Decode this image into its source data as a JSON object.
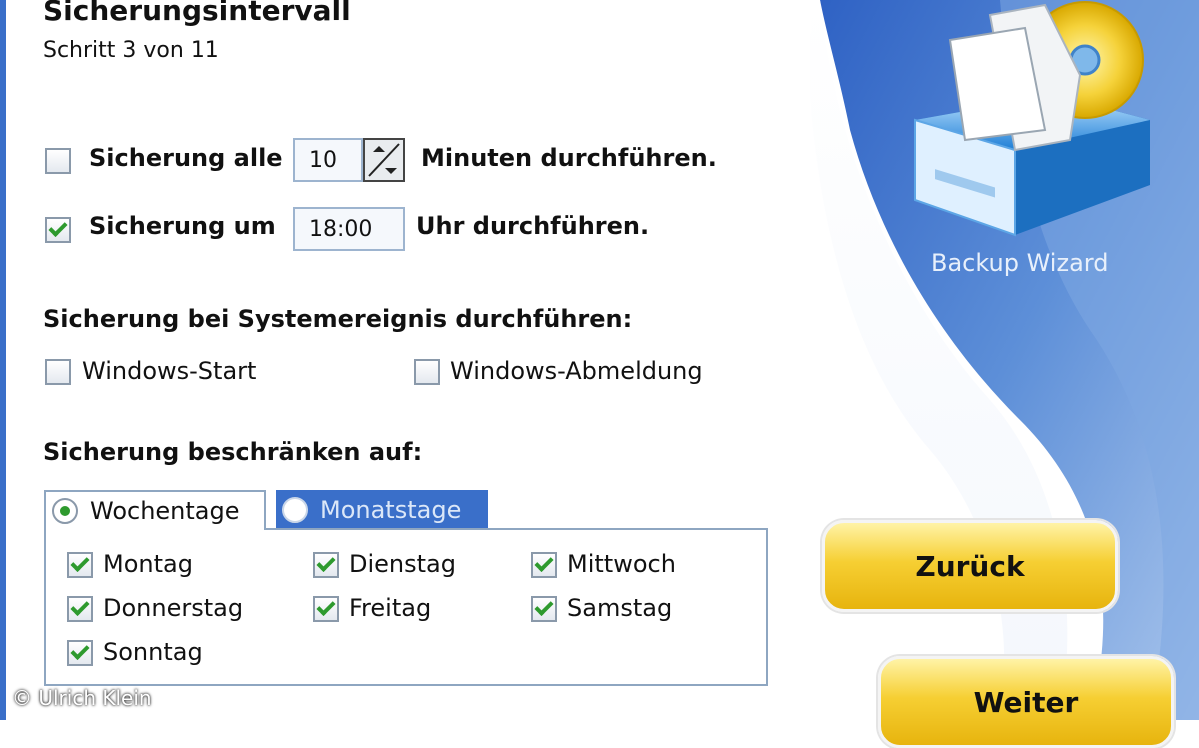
{
  "header": {
    "title": "Sicherungsintervall",
    "step": "Schritt 3 von 11"
  },
  "interval": {
    "every": {
      "checked": false,
      "label": "Sicherung alle",
      "value": "10",
      "suffix": "Minuten durchführen."
    },
    "at": {
      "checked": true,
      "label": "Sicherung um",
      "value": "18:00",
      "suffix": "Uhr durchführen."
    }
  },
  "events": {
    "heading": "Sicherung bei Systemereignis durchführen:",
    "windows_start": {
      "checked": false,
      "label": "Windows-Start"
    },
    "windows_logoff": {
      "checked": false,
      "label": "Windows-Abmeldung"
    }
  },
  "restrict": {
    "heading": "Sicherung beschränken auf:",
    "tabs": [
      {
        "label": "Wochentage",
        "selected": true
      },
      {
        "label": "Monatstage",
        "selected": false
      }
    ],
    "days": [
      {
        "label": "Montag",
        "checked": true
      },
      {
        "label": "Dienstag",
        "checked": true
      },
      {
        "label": "Mittwoch",
        "checked": true
      },
      {
        "label": "Donnerstag",
        "checked": true
      },
      {
        "label": "Freitag",
        "checked": true
      },
      {
        "label": "Samstag",
        "checked": true
      },
      {
        "label": "Sonntag",
        "checked": true
      }
    ]
  },
  "sidebar": {
    "wizard_label": "Backup Wizard",
    "icon": "backup-drive-icon"
  },
  "buttons": {
    "back": "Zurück",
    "next": "Weiter"
  },
  "footer": {
    "copyright": "© Ulrich Klein"
  },
  "colors": {
    "accent_blue": "#3a6fc9",
    "check_green": "#2e9a2e",
    "button_yellow": "#f6cf33"
  }
}
